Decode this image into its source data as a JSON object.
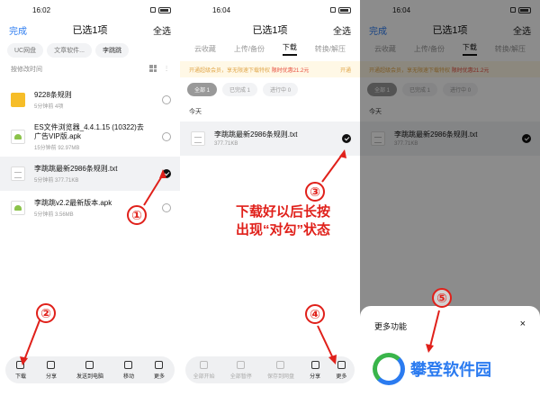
{
  "panel1": {
    "time": "16:02",
    "nav": {
      "left": "完成",
      "title": "已选1项",
      "right": "全选"
    },
    "crumbs": [
      "UC网盘",
      "文章软件...",
      "李跳跳"
    ],
    "sort_label": "按修改时间",
    "files": [
      {
        "name": "9228条规则",
        "meta": "5分钟前  4项",
        "type": "folder",
        "selected": false
      },
      {
        "name": "ES文件浏览器_4.4.1.15 (10322)去广告VIP版.apk",
        "meta": "15分钟前  92.97MB",
        "type": "apk",
        "selected": false
      },
      {
        "name": "李跳跳最新2986条规则.txt",
        "meta": "5分钟前  377.71KB",
        "type": "txt",
        "selected": true
      },
      {
        "name": "李跳跳v2.2最新版本.apk",
        "meta": "5分钟前  3.56MB",
        "type": "apk",
        "selected": false
      }
    ],
    "toolbar": [
      "下载",
      "分享",
      "发送到电脑",
      "移动",
      "更多"
    ]
  },
  "panel2": {
    "time": "16:04",
    "nav": {
      "title": "已选1项",
      "right": "全选"
    },
    "tabs": [
      "云收藏",
      "上传/备份",
      "下载",
      "转换/解压"
    ],
    "active_tab": "下载",
    "banner_text": "开通超级会员，享无限速下载特权",
    "banner_highlight": "限时优惠21.2元",
    "banner_action": "开通",
    "chips": [
      "全部 1",
      "已完成 1",
      "进行中 0"
    ],
    "section": "今天",
    "file": {
      "name": "李跳跳最新2986条规则.txt",
      "meta": "377.71KB"
    },
    "toolbar": [
      "全部开始",
      "全部暂停",
      "保存到网盘",
      "分享",
      "更多"
    ]
  },
  "panel3": {
    "time": "16:04",
    "nav": {
      "left": "完成",
      "title": "已选1项",
      "right": "全选"
    },
    "tabs": [
      "云收藏",
      "上传/备份",
      "下载",
      "转换/解压"
    ],
    "banner_text": "开通超级会员，享无限速下载特权",
    "banner_highlight": "限时优惠21.2元",
    "chips": [
      "全部 1",
      "已完成 1",
      "进行中 0"
    ],
    "section": "今天",
    "file": {
      "name": "李跳跳最新2986条规则.txt",
      "meta": "377.71KB"
    },
    "sheet_title": "更多功能",
    "sheet_close": "×",
    "watermark": "攀登软件园"
  },
  "annotations": {
    "step1": "①",
    "step2": "②",
    "step3": "③",
    "step4": "④",
    "step5": "⑤",
    "instruction_line1": "下载好以后长按",
    "instruction_line2": "出现“对勾”状态"
  },
  "colors": {
    "accent": "#2b7bf0",
    "annotation": "#e0201a"
  }
}
